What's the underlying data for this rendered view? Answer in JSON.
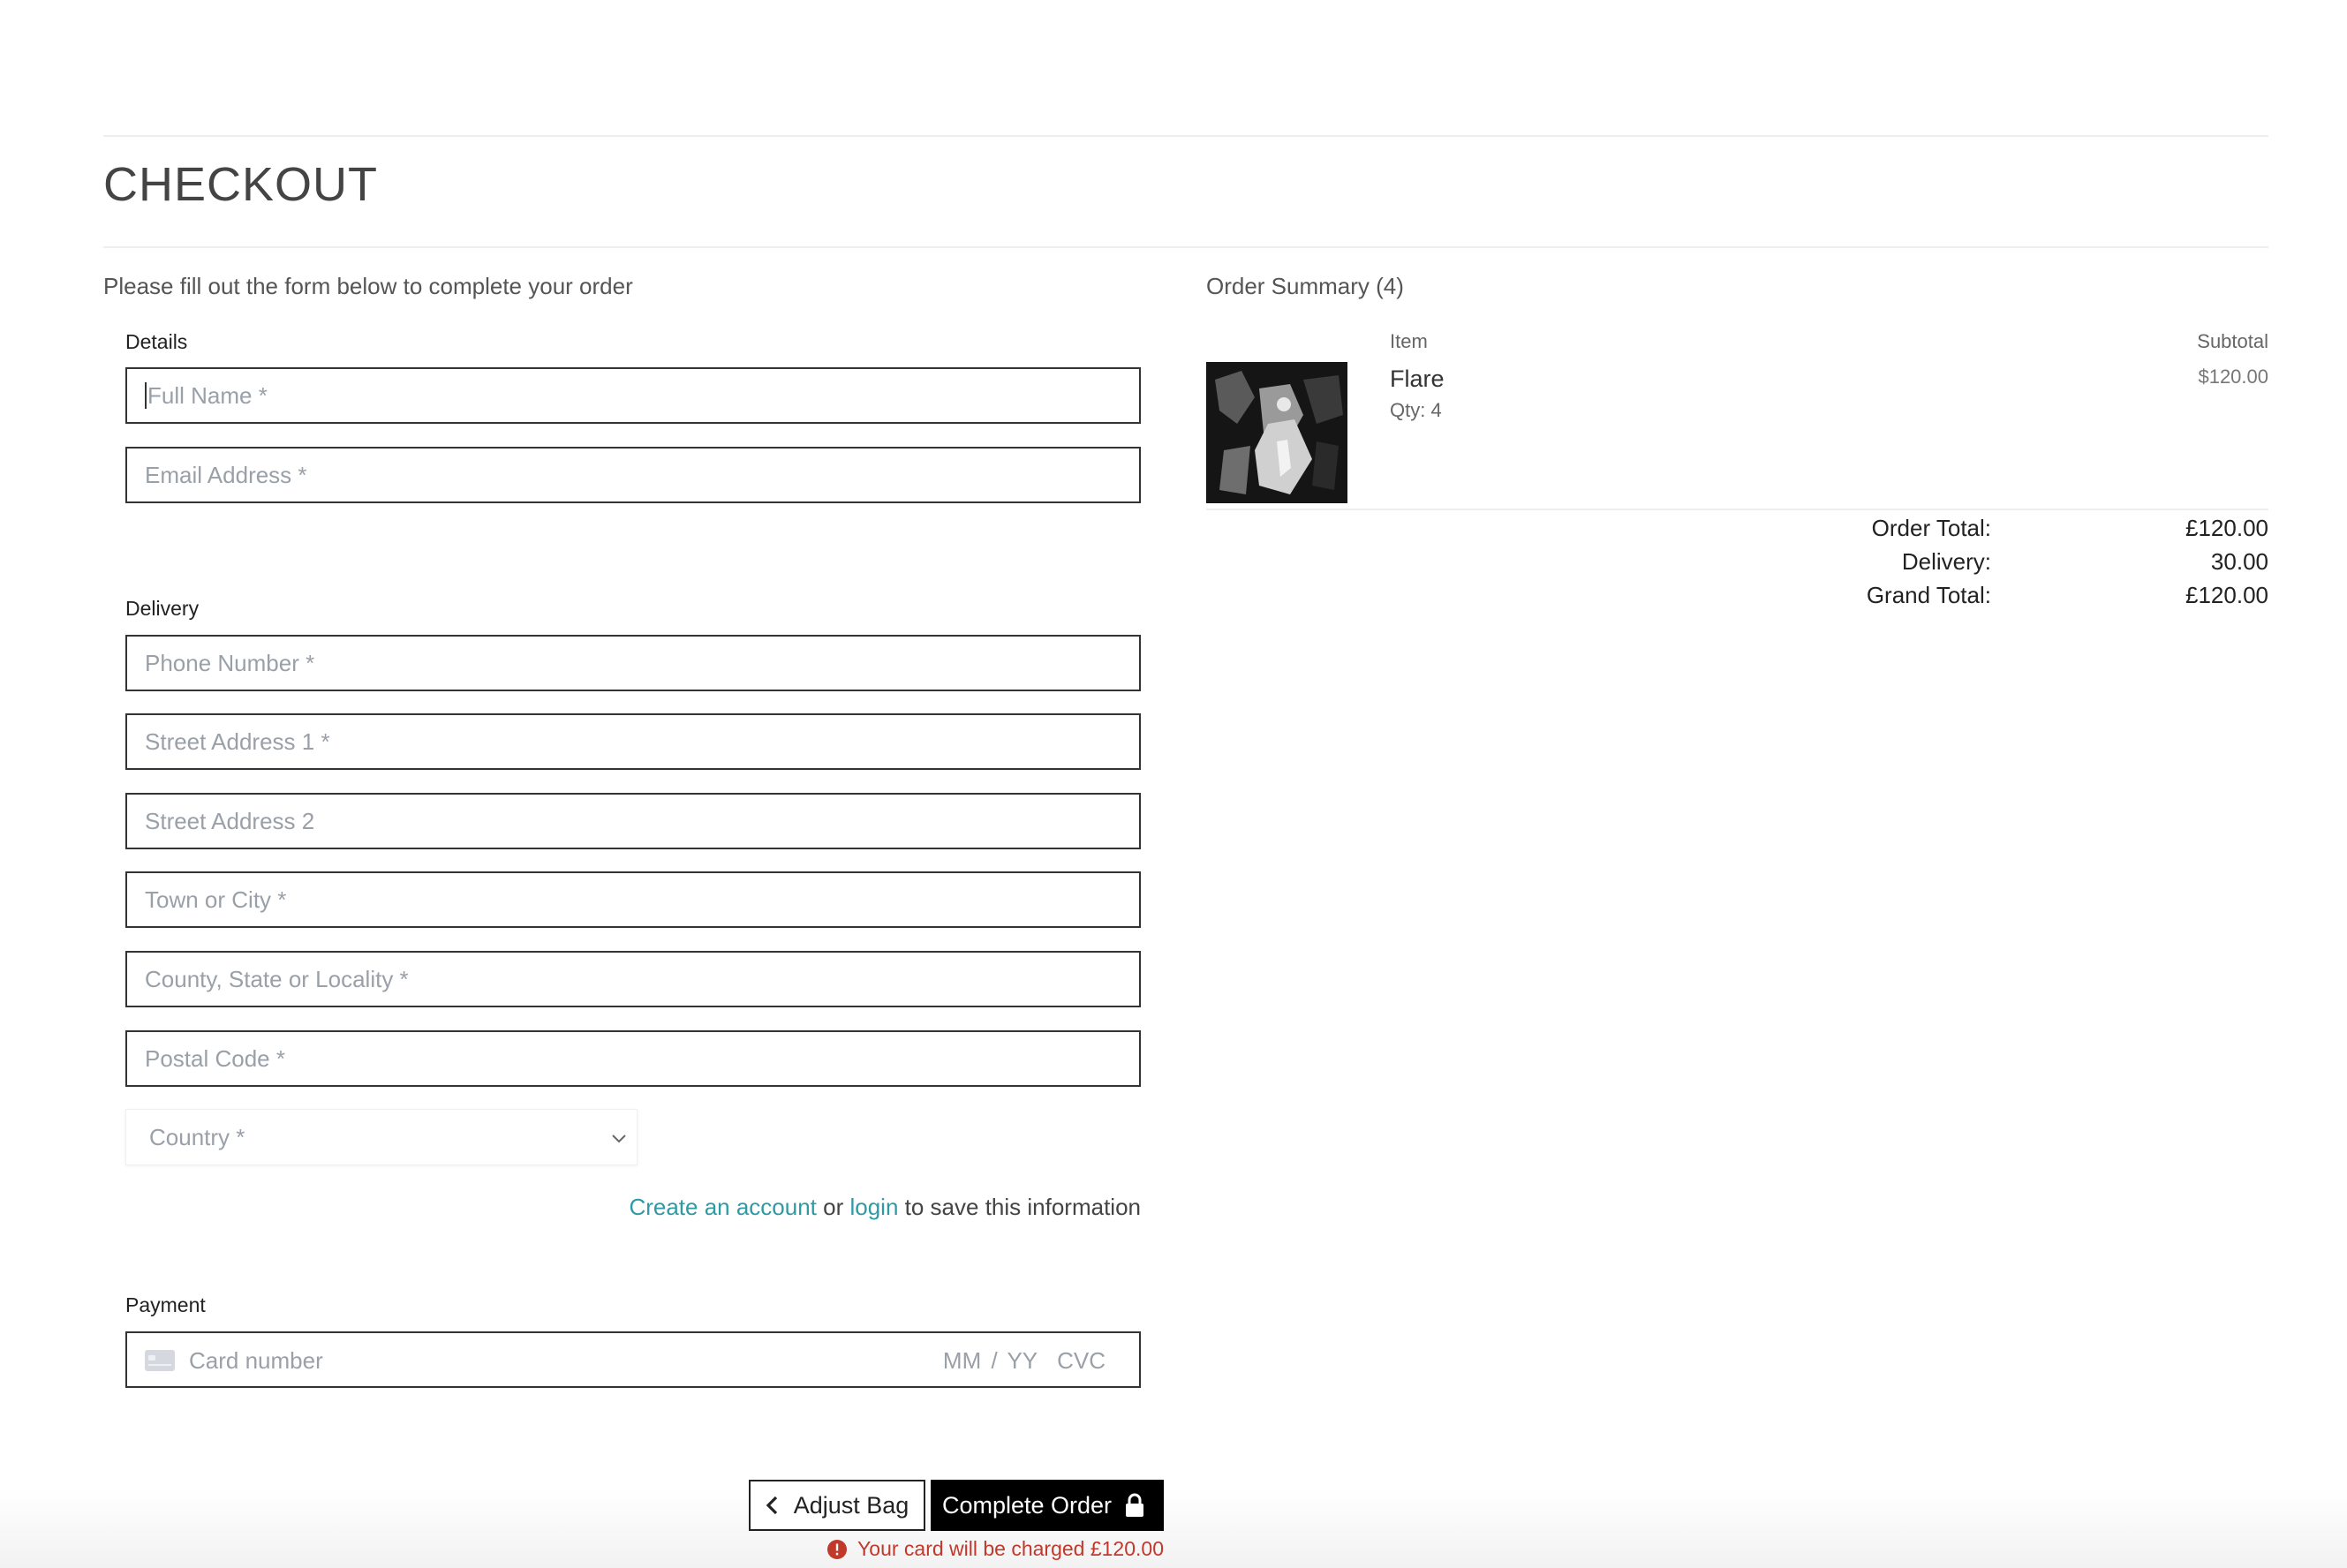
{
  "page": {
    "title": "CHECKOUT",
    "intro": "Please fill out the form below to complete your order"
  },
  "form": {
    "details_label": "Details",
    "full_name_placeholder": "Full Name *",
    "email_placeholder": "Email Address *",
    "delivery_label": "Delivery",
    "phone_placeholder": "Phone Number *",
    "street1_placeholder": "Street Address 1 *",
    "street2_placeholder": "Street Address 2",
    "town_placeholder": "Town or City *",
    "county_placeholder": "County, State or Locality *",
    "postcode_placeholder": "Postal Code *",
    "country_placeholder": "Country *",
    "account_link": "Create an account",
    "account_or": " or ",
    "login_link": "login",
    "account_suffix": " to save this information",
    "payment_label": "Payment",
    "card_placeholder": "Card number",
    "card_expiry_cvc": "MM / YY  CVC"
  },
  "actions": {
    "adjust_bag": "Adjust Bag",
    "complete_order": "Complete Order",
    "charge_note": "Your card will be charged £120.00"
  },
  "summary": {
    "title": "Order Summary (4)",
    "col_item": "Item",
    "col_subtotal": "Subtotal",
    "items": [
      {
        "name": "Flare",
        "qty": "Qty: 4",
        "price": "$120.00"
      }
    ],
    "order_total_label": "Order Total:",
    "order_total_value": "£120.00",
    "delivery_label": "Delivery:",
    "delivery_value": "30.00",
    "grand_total_label": "Grand Total:",
    "grand_total_value": "£120.00"
  },
  "colors": {
    "link": "#2e9aa6",
    "error": "#c0392b",
    "primary_button": "#000000"
  }
}
